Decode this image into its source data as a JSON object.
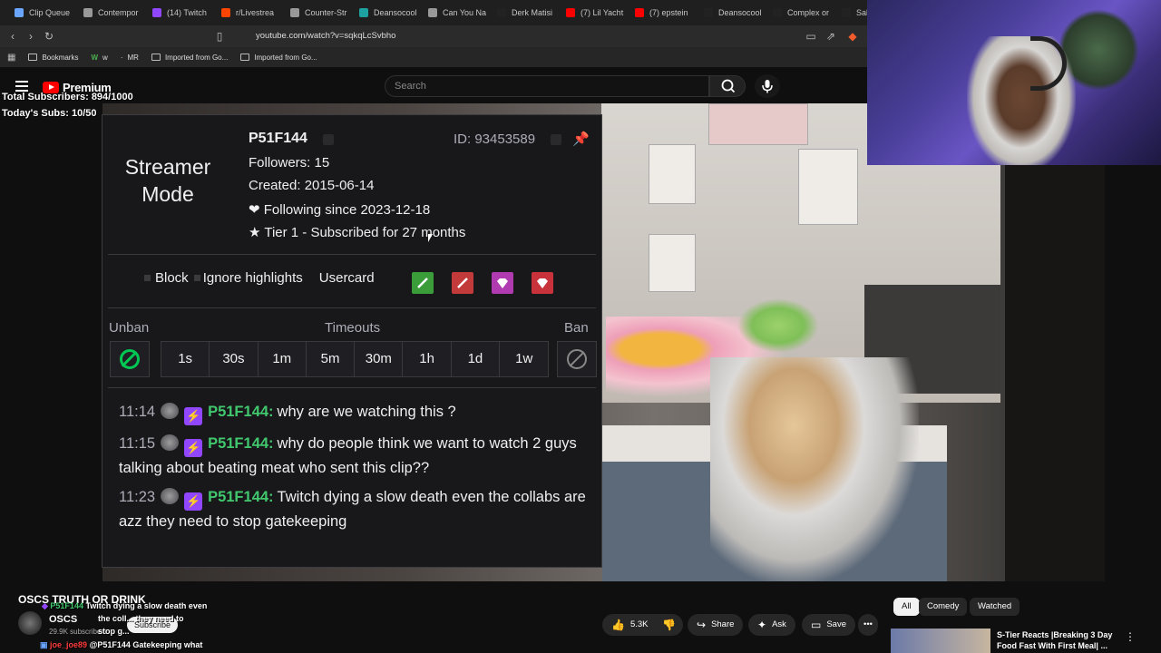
{
  "browser": {
    "tabs": [
      {
        "label": "Clip Queue",
        "color": "#6aa6ff"
      },
      {
        "label": "Contempor",
        "color": "#999999"
      },
      {
        "label": "(14) Twitch",
        "color": "#9147ff"
      },
      {
        "label": "r/Livestrea",
        "color": "#ff4500"
      },
      {
        "label": "Counter-Str",
        "color": "#999999"
      },
      {
        "label": "Deansocool",
        "color": "#1da1a1"
      },
      {
        "label": "Can You Na",
        "color": "#999999"
      },
      {
        "label": "Derk Matisi",
        "color": "#222222"
      },
      {
        "label": "(7) Lil Yacht",
        "color": "#ff0000"
      },
      {
        "label": "(7) epstein",
        "color": "#ff0000"
      },
      {
        "label": "Deansocool",
        "color": "#222222"
      },
      {
        "label": "Complex or",
        "color": "#222222"
      },
      {
        "label": "Salt",
        "color": "#222222"
      }
    ],
    "url": "youtube.com/watch?v=sqkqLcSvbho",
    "bookmarks": [
      {
        "label": "Bookmarks"
      },
      {
        "label": "w"
      },
      {
        "label": "MR"
      },
      {
        "label": "Imported from Go..."
      },
      {
        "label": "Imported from Go..."
      }
    ]
  },
  "youtube": {
    "logo_text": "Premium",
    "search_placeholder": "Search"
  },
  "overlay": {
    "total_subs": "Total Subscribers: 894/1000",
    "today_subs": "Today's Subs: 10/50"
  },
  "usercard": {
    "streamer_mode": "Streamer Mode",
    "username": "P51F144",
    "id": "ID: 93453589",
    "followers": "Followers: 15",
    "created": "Created: 2015-06-14",
    "following": "❤ Following since 2023-12-18",
    "tier": "★ Tier 1 - Subscribed for 27 months",
    "actions": {
      "block": "Block",
      "ignore": "Ignore highlights",
      "usercard": "Usercard"
    },
    "mod_labels": {
      "unban": "Unban",
      "timeouts": "Timeouts",
      "ban": "Ban"
    },
    "timeouts": [
      "1s",
      "30s",
      "1m",
      "5m",
      "30m",
      "1h",
      "1d",
      "1w"
    ],
    "badge_colors": [
      "#3a9d3a",
      "#c23a3a",
      "#b03ab0",
      "#c8323a"
    ],
    "messages": [
      {
        "time": "11:14",
        "user": "P51F144:",
        "text": "why are we watching this ?"
      },
      {
        "time": "11:15",
        "user": "P51F144:",
        "text": "why do people think we want to watch 2 guys talking about beating meat who sent this clip??"
      },
      {
        "time": "11:23",
        "user": "P51F144:",
        "text": "Twitch dying a slow death even the collabs are azz they need to stop gatekeeping"
      }
    ]
  },
  "below_video": {
    "title": "OSCS TRUTH OR DRINK",
    "channel": "OSCS",
    "subs": "29.9K subscribers",
    "subscribe": "Subscribe",
    "chat_overlay": [
      {
        "user": "P51F144",
        "text": "Twitch dying a slow death even"
      },
      {
        "user": "",
        "text": "the coll... they need to"
      },
      {
        "user": "",
        "text": "stop g..."
      },
      {
        "user": "joe_joe89",
        "text": "@P51F144 Gatekeeping what"
      }
    ],
    "likes": "5.3K",
    "share": "Share",
    "ask": "Ask",
    "save": "Save",
    "chips": [
      "All",
      "Comedy",
      "Watched"
    ],
    "rec_title": "S-Tier Reacts |Breaking 3 Day Food Fast With First Meal| ..."
  }
}
